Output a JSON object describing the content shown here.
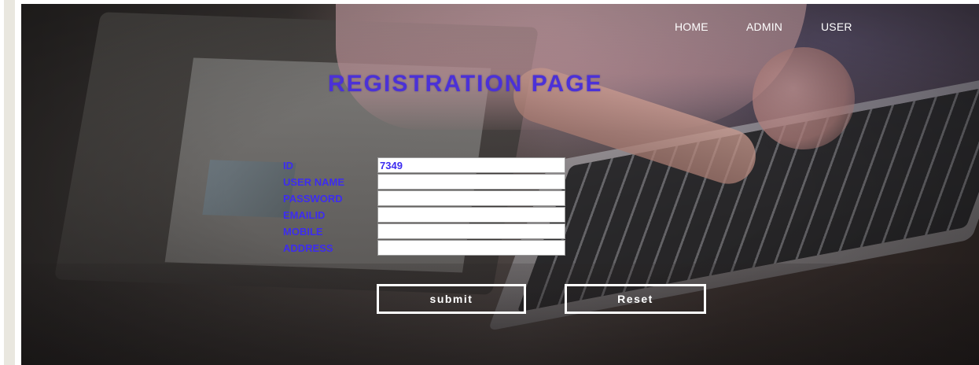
{
  "nav": {
    "items": [
      {
        "label": "HOME"
      },
      {
        "label": "ADMIN"
      },
      {
        "label": "USER"
      }
    ]
  },
  "page": {
    "title": "REGISTRATION PAGE"
  },
  "form": {
    "fields": [
      {
        "label": "ID",
        "value": "7349"
      },
      {
        "label": "USER NAME",
        "value": ""
      },
      {
        "label": "PASSWORD",
        "value": ""
      },
      {
        "label": "EMAILID",
        "value": ""
      },
      {
        "label": "MOBILE",
        "value": ""
      },
      {
        "label": "ADDRESS",
        "value": ""
      }
    ],
    "submit_label": "submit",
    "reset_label": "Reset"
  },
  "colors": {
    "title": "#4b31d7",
    "label": "#3d2cf0",
    "button_border": "#ffffff"
  }
}
